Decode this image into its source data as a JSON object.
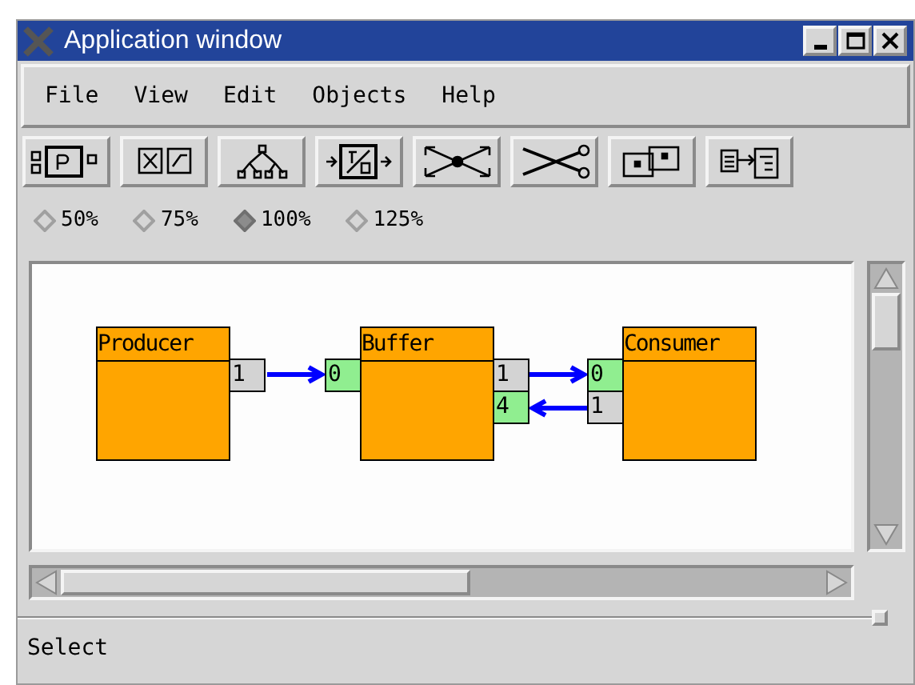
{
  "window": {
    "title": "Application window"
  },
  "menu": [
    {
      "label": "File"
    },
    {
      "label": "View"
    },
    {
      "label": "Edit"
    },
    {
      "label": "Objects"
    },
    {
      "label": "Help"
    }
  ],
  "zoom_options": [
    {
      "label": "50%",
      "selected": false
    },
    {
      "label": "75%",
      "selected": false
    },
    {
      "label": "100%",
      "selected": true
    },
    {
      "label": "125%",
      "selected": false
    }
  ],
  "diagram": {
    "nodes": [
      {
        "title": "Producer",
        "right_ports": [
          {
            "label": "1",
            "kind": "output"
          }
        ]
      },
      {
        "title": "Buffer",
        "left_ports": [
          {
            "label": "0",
            "kind": "input"
          }
        ],
        "right_ports": [
          {
            "label": "1",
            "kind": "output"
          },
          {
            "label": "4",
            "kind": "input"
          }
        ]
      },
      {
        "title": "Consumer",
        "left_ports": [
          {
            "label": "0",
            "kind": "input"
          },
          {
            "label": "1",
            "kind": "output"
          }
        ]
      }
    ]
  },
  "status_bar": {
    "text": "Select"
  }
}
